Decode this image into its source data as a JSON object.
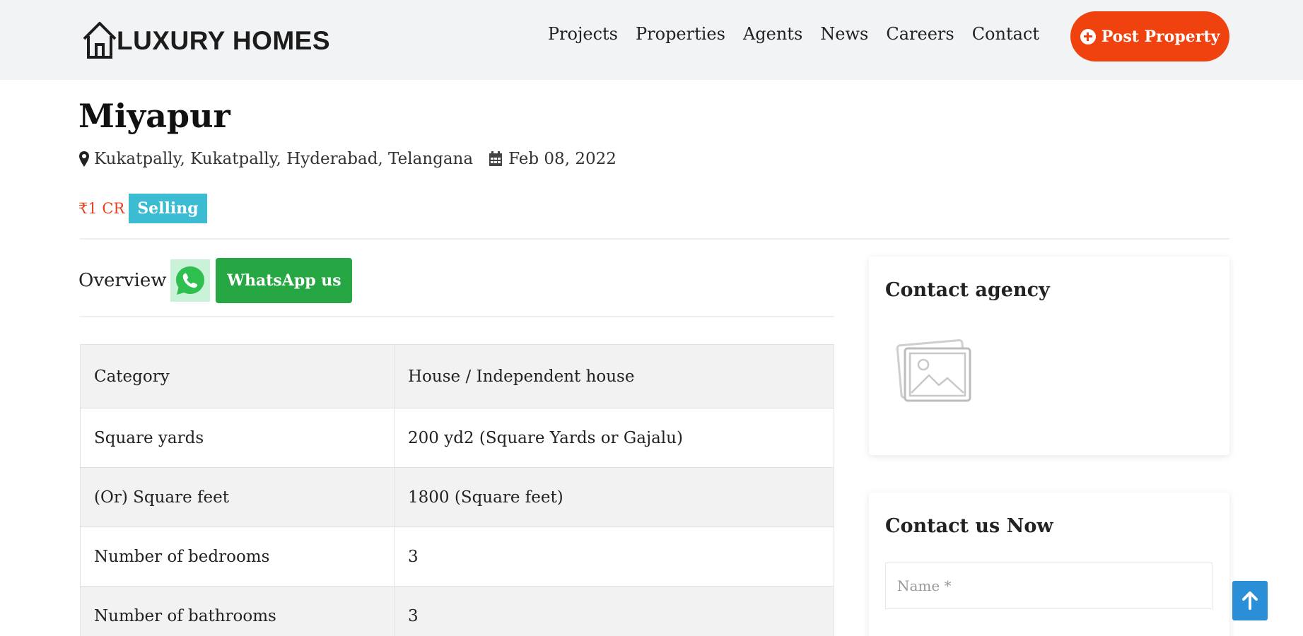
{
  "header": {
    "logo_text": "LUXURY HOMES",
    "nav": [
      "Projects",
      "Properties",
      "Agents",
      "News",
      "Careers",
      "Contact"
    ],
    "post_button": "Post Property"
  },
  "property": {
    "title": "Miyapur",
    "location": "Kukatpally, Kukatpally, Hyderabad, Telangana",
    "date": "Feb 08, 2022",
    "price": "₹1 CR",
    "status": "Selling"
  },
  "overview": {
    "label": "Overview",
    "whatsapp_button": "WhatsApp us"
  },
  "specs": [
    {
      "key": "Category",
      "value": "House / Independent house"
    },
    {
      "key": "Square yards",
      "value": "200 yd2 (Square Yards or Gajalu)"
    },
    {
      "key": "(Or) Square feet",
      "value": "1800 (Square feet)"
    },
    {
      "key": "Number of bedrooms",
      "value": "3"
    },
    {
      "key": "Number of bathrooms",
      "value": "3"
    }
  ],
  "sidebar": {
    "agency_title": "Contact agency",
    "contact_title": "Contact us Now",
    "name_placeholder": "Name *"
  },
  "colors": {
    "accent": "#f0420f",
    "badge": "#3bbcd2",
    "whatsapp": "#27a744",
    "scroll_top": "#2b8fd8"
  },
  "icons": [
    "house-logo-icon",
    "plus-circle-icon",
    "map-marker-icon",
    "calendar-icon",
    "whatsapp-icon",
    "image-placeholder-icon",
    "arrow-up-icon"
  ]
}
